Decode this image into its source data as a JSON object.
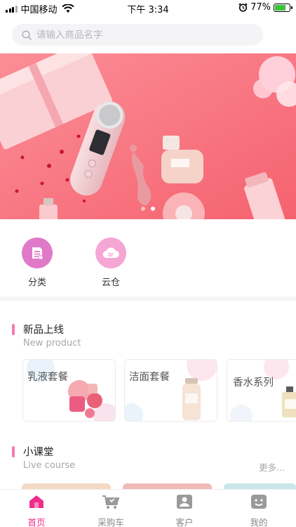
{
  "status_bar": {
    "carrier": "中国移动",
    "time": "下午 3:34",
    "battery": "77%"
  },
  "search": {
    "placeholder": "请输入商品名字"
  },
  "categories": [
    {
      "label": "分类",
      "icon": "document-icon",
      "color": "#e07ac8"
    },
    {
      "label": "云仓",
      "icon": "cloud-icon",
      "color": "#f6a6d4"
    }
  ],
  "new_product": {
    "title": "新品上线",
    "subtitle": "New product",
    "cards": [
      {
        "label": "乳液套餐"
      },
      {
        "label": "洁面套餐"
      },
      {
        "label": "香水系列"
      }
    ]
  },
  "course": {
    "title": "小课堂",
    "subtitle": "Live course",
    "more": "更多..."
  },
  "tabbar": {
    "items": [
      {
        "label": "首页",
        "icon": "home-icon",
        "active": true
      },
      {
        "label": "采购车",
        "icon": "cart-icon",
        "active": false
      },
      {
        "label": "客户",
        "icon": "customer-icon",
        "active": false
      },
      {
        "label": "我的",
        "icon": "profile-icon",
        "active": false
      }
    ]
  },
  "colors": {
    "accent": "#ee2e8a",
    "section_bar": "#f57bb0",
    "banner_bg": "#f7707e"
  }
}
